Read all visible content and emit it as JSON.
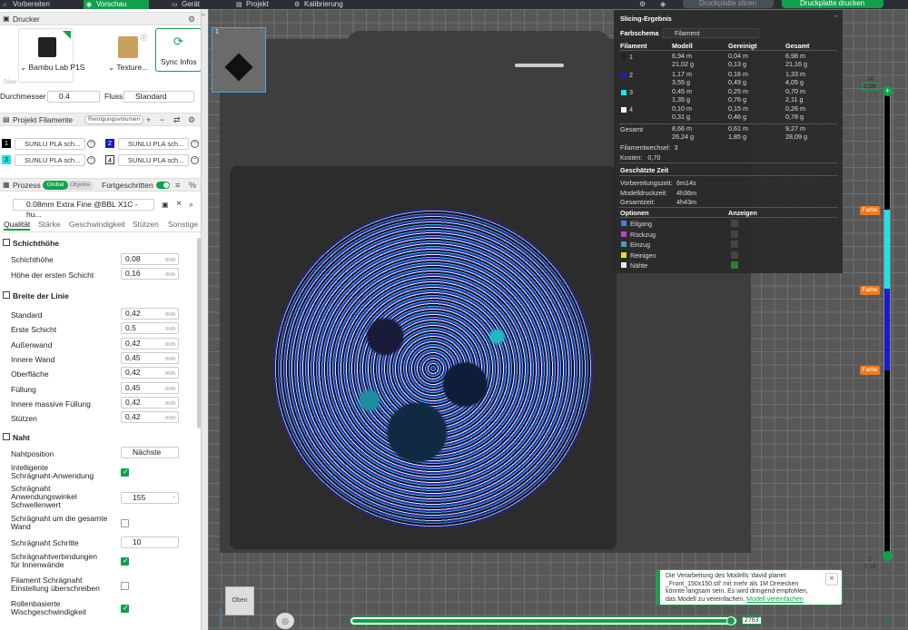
{
  "topbar": {
    "tabs": [
      "Vorbereiten",
      "Vorschau",
      "Gerät",
      "Projekt",
      "Kalibrierung"
    ],
    "slice_button": "Druckplatte slicen",
    "print_button": "Druckplatte drucken"
  },
  "printer": {
    "section_title": "Drucker",
    "printer_name": "Bambu Lab P1S",
    "plate_name": "Texture...",
    "sync_label": "Sync Infos",
    "nozzle_label": "Düse",
    "diameter_label": "Durchmesser",
    "diameter_value": "0.4",
    "flow_label": "Fluss",
    "flow_value": "Standard"
  },
  "filaments": {
    "section_title": "Projekt Filamente",
    "purge_label": "Reinigungsvolumen",
    "slots": [
      {
        "num": "1",
        "name": "SUNLU PLA sch...",
        "color": "#000000"
      },
      {
        "num": "2",
        "name": "SUNLU PLA sch...",
        "color": "#1a1ad0"
      },
      {
        "num": "3",
        "name": "SUNLU PLA sch...",
        "color": "#22e0e8"
      },
      {
        "num": "4",
        "name": "SUNLU PLA sch...",
        "color": "#ffffff"
      }
    ]
  },
  "process": {
    "section_title": "Prozess",
    "toggle_global": "Global",
    "toggle_objects": "Objekte",
    "advanced_label": "Fortgeschritten",
    "preset": "0.08mm Extra Fine @BBL X1C - hu...",
    "tabs": [
      "Qualität",
      "Stärke",
      "Geschwindigkeit",
      "Stützen",
      "Sonstige"
    ]
  },
  "quality": {
    "layer_group": "Schichthöhe",
    "layer_height_label": "Schichthöhe",
    "layer_height_value": "0,08",
    "first_layer_label": "Höhe der ersten Schicht",
    "first_layer_value": "0,16",
    "unit_mm": "mm",
    "width_group": "Breite der Linie",
    "widths": [
      {
        "label": "Standard",
        "value": "0,42",
        "unit": "mm"
      },
      {
        "label": "Erste Schicht",
        "value": "0,5",
        "unit": "mm"
      },
      {
        "label": "Außenwand",
        "value": "0,42",
        "unit": "mm"
      },
      {
        "label": "Innere Wand",
        "value": "0,45",
        "unit": "mm"
      },
      {
        "label": "Oberfläche",
        "value": "0,42",
        "unit": "mm"
      },
      {
        "label": "Füllung",
        "value": "0,45",
        "unit": "mm"
      },
      {
        "label": "Innere massive Füllung",
        "value": "0,42",
        "unit": "mm"
      },
      {
        "label": "Stützen",
        "value": "0,42",
        "unit": "mm"
      }
    ],
    "seam_group": "Naht",
    "seam_position_label": "Nahtposition",
    "seam_position_value": "Nächste",
    "smart_scarf_label_1": "Intelligente",
    "smart_scarf_label_2": "Schrägnaht-Anwendung",
    "scarf_angle_label_1": "Schrägnaht",
    "scarf_angle_label_2": "Anwendungswinkel",
    "scarf_angle_label_3": "Schwellenwert",
    "scarf_angle_value": "155",
    "scarf_angle_unit": "°",
    "scarf_whole_label_1": "Schrägnaht um die gesamte",
    "scarf_whole_label_2": "Wand",
    "scarf_steps_label": "Schrägnaht Schritte",
    "scarf_steps_value": "10",
    "scarf_inner_label_1": "Schrägnahtverbindungen",
    "scarf_inner_label_2": "für Innenwände",
    "scarf_override_label_1": "Filament Schrägnaht",
    "scarf_override_label_2": "Einstellung überschreiben",
    "roll_label_1": "Rollenbasierte",
    "roll_label_2": "Wischgeschwindigkeit"
  },
  "viewport": {
    "plate_index": "1",
    "view_label": "Oben"
  },
  "result": {
    "title": "Slicing-Ergebnis",
    "scheme_label": "Farbschema",
    "scheme_value": "Filament",
    "headers": [
      "Filament",
      "Modell",
      "Gereinigt",
      "Gesamt"
    ],
    "rows": [
      {
        "id": "1",
        "color": "#222222",
        "model_m": "6,94 m",
        "model_g": "21,02 g",
        "purge_m": "0,04 m",
        "purge_g": "0,13 g",
        "total_m": "6,98 m",
        "total_g": "21,16 g"
      },
      {
        "id": "2",
        "color": "#1a1ad0",
        "model_m": "1,17 m",
        "model_g": "3,55 g",
        "purge_m": "0,16 m",
        "purge_g": "0,49 g",
        "total_m": "1,33 m",
        "total_g": "4,05 g"
      },
      {
        "id": "3",
        "color": "#22e0e8",
        "model_m": "0,45 m",
        "model_g": "1,35 g",
        "purge_m": "0,25 m",
        "purge_g": "0,76 g",
        "total_m": "0,70 m",
        "total_g": "2,11 g"
      },
      {
        "id": "4",
        "color": "#ffffff",
        "model_m": "0,10 m",
        "model_g": "0,31 g",
        "purge_m": "0,15 m",
        "purge_g": "0,46 g",
        "total_m": "0,26 m",
        "total_g": "0,78 g"
      }
    ],
    "total_label": "Gesamt",
    "total": {
      "model_m": "8,66 m",
      "model_g": "26,24 g",
      "purge_m": "0,61 m",
      "purge_g": "1,85 g",
      "total_m": "9,27 m",
      "total_g": "28,09 g"
    },
    "changes_label": "Filamentwechsel:",
    "changes_value": "3",
    "cost_label": "Kosten:",
    "cost_value": "0,70",
    "time_title": "Geschätzte Zeit",
    "prep_label": "Vorbereitungszeit:",
    "prep_value": "6m14s",
    "model_time_label": "Modelldruckzeit:",
    "model_time_value": "4h36m",
    "total_time_label": "Gesamtzeit:",
    "total_time_value": "4h43m",
    "options_label": "Optionen",
    "show_label": "Anzeigen",
    "options": [
      {
        "name": "Eilgang",
        "color": "#4a7ed8",
        "checked": false
      },
      {
        "name": "Rückzug",
        "color": "#c040c0",
        "checked": false
      },
      {
        "name": "Einzug",
        "color": "#40a0c0",
        "checked": false
      },
      {
        "name": "Reinigen",
        "color": "#e0e030",
        "checked": false
      },
      {
        "name": "Nähte",
        "color": "#eeeeee",
        "checked": true
      }
    ]
  },
  "layer_slider": {
    "top_index": "24",
    "top_height": "2,00",
    "bottom_index": "1",
    "bottom_height": "0,16",
    "farbe_label": "Farbe"
  },
  "move_slider": {
    "value": "2763"
  },
  "notification": {
    "text_1": "Die Verarbeitung des Modells 'david planet",
    "text_2": "_Front_150x150.stl' mit mehr als 1M Dreiecken",
    "text_3": "könnte langsam sein. Es wird dringend empfohlen,",
    "text_4": "das Modell zu vereinfachen.",
    "link": "Modell vereinfachen"
  }
}
